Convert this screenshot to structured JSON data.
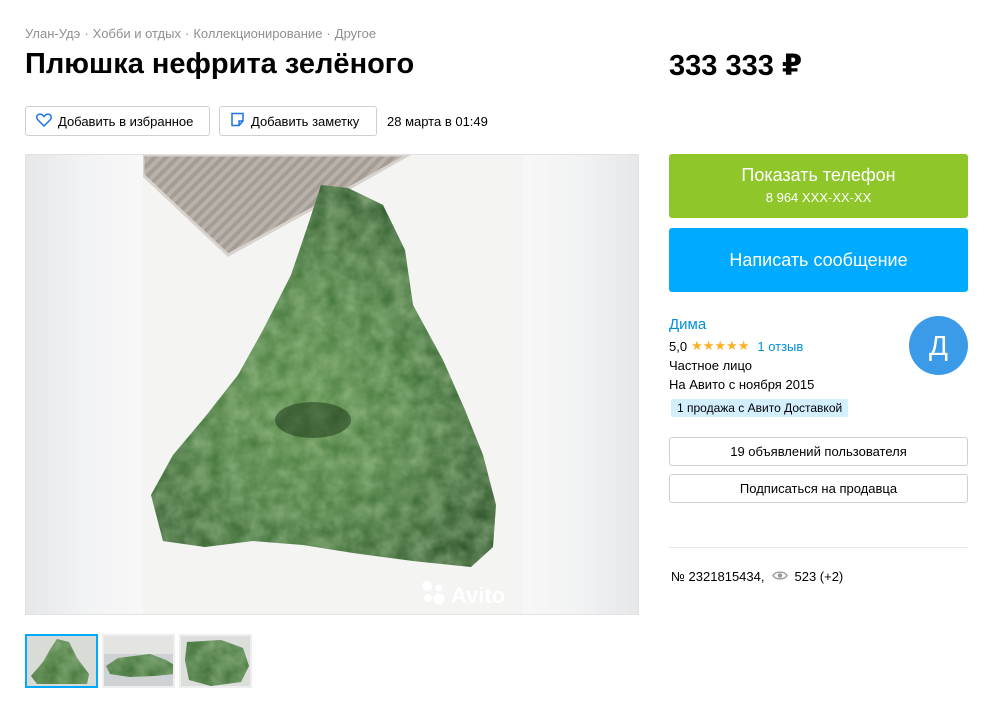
{
  "breadcrumbs": [
    "Улан-Удэ",
    "Хобби и отдых",
    "Коллекционирование",
    "Другое"
  ],
  "breadcrumb_separator": "·",
  "title": "Плюшка нефрита зелёного",
  "price": "333 333 ₽",
  "actions": {
    "favorite_label": "Добавить в избранное",
    "note_label": "Добавить заметку",
    "date": "28 марта в 01:49"
  },
  "gallery": {
    "watermark": "Avito",
    "thumbnail_count": 3,
    "active_index": 0
  },
  "contact": {
    "phone_label": "Показать телефон",
    "phone_masked": "8 964 XXX-XX-XX",
    "message_label": "Написать сообщение",
    "phone_color": "#8fc62a",
    "message_color": "#00aaff"
  },
  "seller": {
    "name": "Дима",
    "rating": "5,0",
    "stars": "★★★★★",
    "reviews": "1 отзыв",
    "type": "Частное лицо",
    "since": "На Авито с ноября 2015",
    "delivery_badge": "1 продажа с Авито Доставкой",
    "avatar_letter": "Д",
    "avatar_color": "#3c9be8"
  },
  "seller_actions": {
    "ads_label": "19 объявлений пользователя",
    "subscribe_label": "Подписаться на продавца"
  },
  "meta": {
    "item_number": "№ 2321815434,",
    "views": "523 (+2)"
  },
  "icons": {
    "favorite": "heart-icon",
    "note": "note-icon",
    "views": "eye-icon",
    "watermark": "avito-logo-icon"
  }
}
